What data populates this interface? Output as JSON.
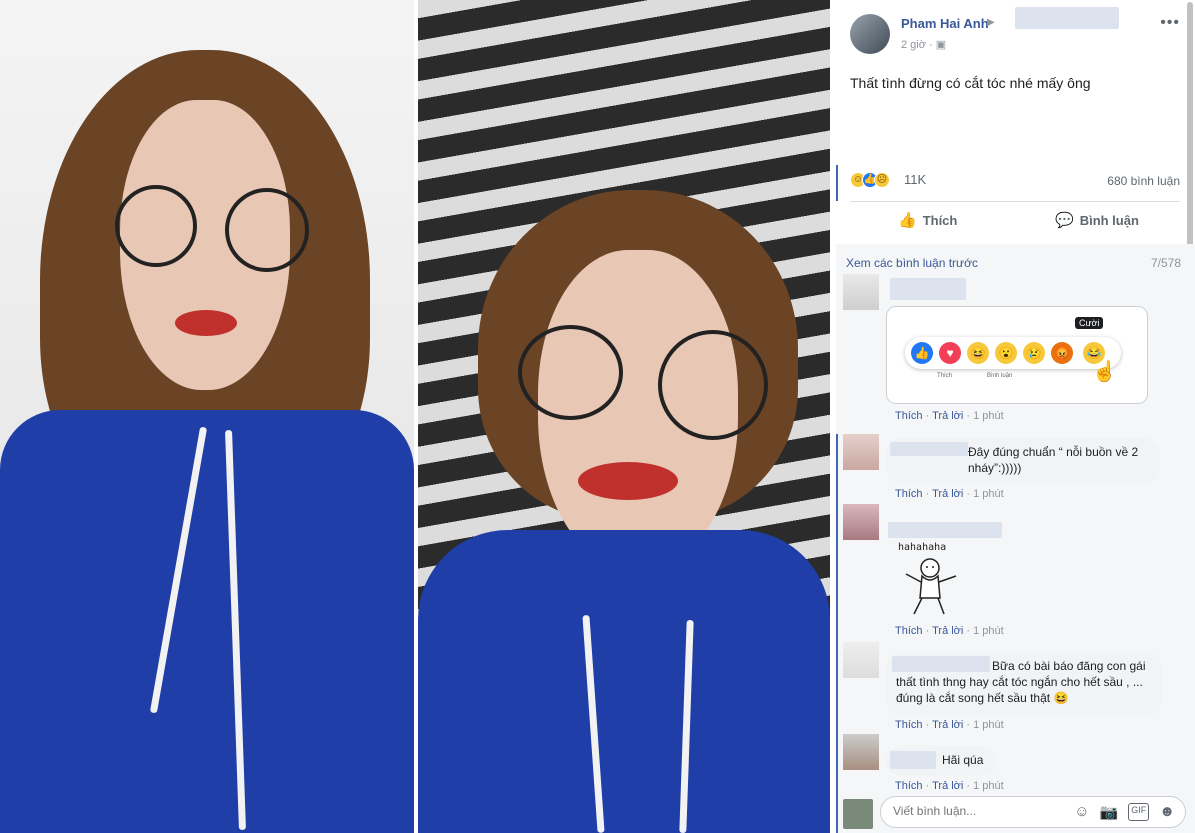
{
  "post": {
    "author": "Pham Hai Anh",
    "time": "2 giờ",
    "text": "Thất tình đừng có cắt tóc nhé mấy ông",
    "reaction_count": "11K",
    "comment_count": "680 bình luận"
  },
  "actions": {
    "like": "Thích",
    "comment": "Bình luận"
  },
  "comments_section": {
    "see_previous": "Xem các bình luận trước",
    "page_indicator": "7/578"
  },
  "comments": [
    {
      "text": "",
      "image_tooltip": "Cười",
      "image_like": "Thích",
      "image_comment": "Bình luận",
      "like": "Thích",
      "reply": "Trả lời",
      "time": "1 phút"
    },
    {
      "text": "Đây đúng chuẩn “ nỗi buồn về 2 nháy”:)))))",
      "like": "Thích",
      "reply": "Trả lời",
      "time": "1 phút"
    },
    {
      "text": "",
      "sticker_caption": "hahahaha",
      "like": "Thích",
      "reply": "Trả lời",
      "time": "1 phút"
    },
    {
      "text": "Bữa có bài báo đăng con gái thất tình thng hay cắt tóc ngắn cho hết sầu , ... đúng là cắt song hết sầu thật",
      "like": "Thích",
      "reply": "Trả lời",
      "time": "1 phút"
    },
    {
      "text": "Hãi qúa",
      "like": "Thích",
      "reply": "Trả lời",
      "time": "1 phút"
    }
  ],
  "composer": {
    "placeholder": "Viết bình luận..."
  },
  "icons": [
    "more-icon",
    "like-icon",
    "comment-icon",
    "emoji-icon",
    "camera-icon",
    "gif-icon",
    "sticker-icon",
    "cursor-icon"
  ],
  "colors": {
    "link": "#385898",
    "accent": "#4267b2",
    "hoodie": "#1f3ea8"
  }
}
